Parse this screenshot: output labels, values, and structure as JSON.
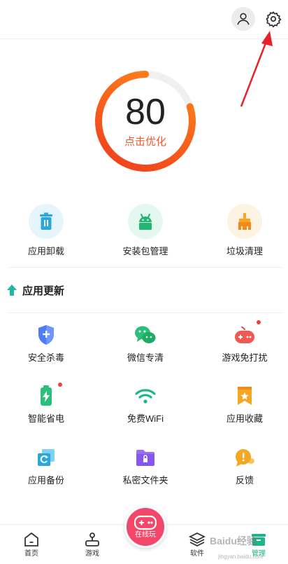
{
  "header": {
    "user_icon": "user-icon",
    "settings_icon": "gear-icon"
  },
  "score": {
    "value": "80",
    "label": "点击优化",
    "ring_fraction": 0.8,
    "colors": {
      "start": "#f03a1e",
      "end": "#ff8a1a"
    }
  },
  "tools": [
    {
      "label": "应用卸载",
      "icon": "trash-icon",
      "bg": "#e6f4fb"
    },
    {
      "label": "安装包管理",
      "icon": "android-icon",
      "bg": "#e5f8ef"
    },
    {
      "label": "垃圾清理",
      "icon": "broom-icon",
      "bg": "#fdf3e3"
    }
  ],
  "section": {
    "title": "应用更新",
    "icon": "arrow-up-icon"
  },
  "features": [
    {
      "label": "安全杀毒",
      "icon": "shield-icon"
    },
    {
      "label": "微信专清",
      "icon": "wechat-icon"
    },
    {
      "label": "游戏免打扰",
      "icon": "gamepad-icon"
    },
    {
      "label": "智能省电",
      "icon": "battery-icon"
    },
    {
      "label": "免费WiFi",
      "icon": "wifi-icon"
    },
    {
      "label": "应用收藏",
      "icon": "bookmark-icon"
    },
    {
      "label": "应用备份",
      "icon": "backup-icon"
    },
    {
      "label": "私密文件夹",
      "icon": "folder-lock-icon"
    },
    {
      "label": "反馈",
      "icon": "feedback-icon"
    }
  ],
  "bottom_nav": {
    "tabs": [
      {
        "label": "首页",
        "icon": "home-icon"
      },
      {
        "label": "游戏",
        "icon": "joystick-icon"
      },
      {
        "label": "软件",
        "icon": "layers-icon"
      },
      {
        "label": "管理",
        "icon": "manage-icon",
        "active": true
      }
    ],
    "center": {
      "label": "在线玩",
      "icon": "gamepad-icon"
    }
  },
  "watermark": {
    "text": "Baidu经验",
    "sub": "jingyan.baidu.com"
  },
  "accent": "#f05a28",
  "active_color": "#1fb58a"
}
